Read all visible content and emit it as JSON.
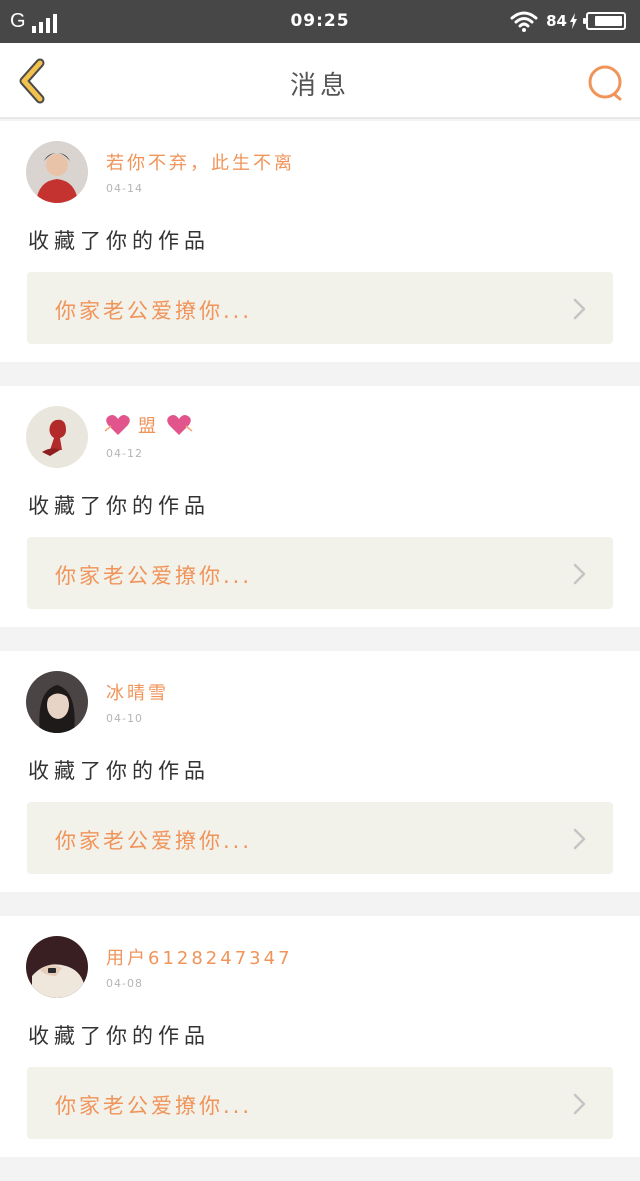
{
  "status_bar": {
    "carrier": "G",
    "time": "09:25",
    "battery_text": "84",
    "battery_level": 0.84
  },
  "header": {
    "title": "消息",
    "back_icon": "chevron-left-icon",
    "search_icon": "search-icon"
  },
  "colors": {
    "accent": "#f0945a",
    "back_icon": "#f2c14e",
    "card_box": "#f2f1ea"
  },
  "notifications": [
    {
      "username": "若你不弃，此生不离",
      "date": "04-14",
      "action": "收藏了你的作品",
      "work_title": "你家老公爱撩你..."
    },
    {
      "username": "盟",
      "date": "04-12",
      "action": "收藏了你的作品",
      "work_title": "你家老公爱撩你..."
    },
    {
      "username": "冰晴雪",
      "date": "04-10",
      "action": "收藏了你的作品",
      "work_title": "你家老公爱撩你..."
    },
    {
      "username": "用户6128247347",
      "date": "04-08",
      "action": "收藏了你的作品",
      "work_title": "你家老公爱撩你..."
    }
  ]
}
